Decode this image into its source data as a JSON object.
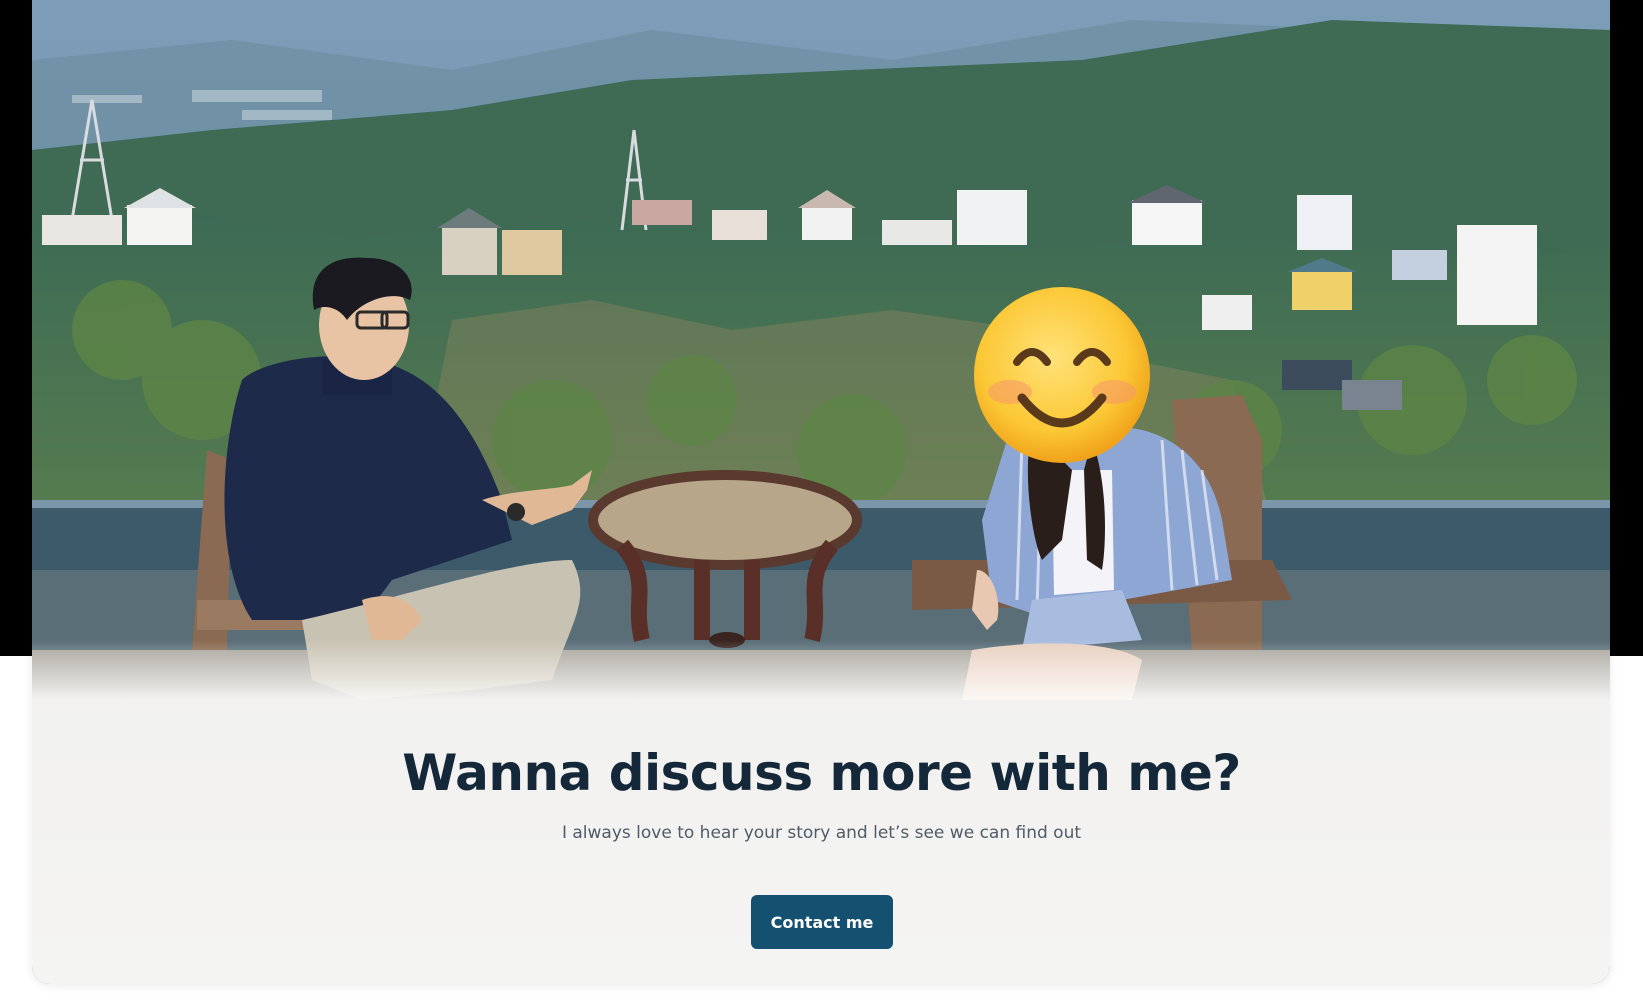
{
  "hero": {
    "image": "photo of two people seated at a small wooden table on a rooftop terrace overlooking a hillside town",
    "face_emoji": "smiling-face-emoji"
  },
  "cta": {
    "title": "Wanna discuss more with me?",
    "subtitle": "I always love to hear your story and let’s see we can find out",
    "button_label": "Contact me"
  },
  "colors": {
    "title": "#14283a",
    "subtitle": "#4f5b66",
    "button_bg": "#14506f",
    "button_text": "#ffffff"
  }
}
